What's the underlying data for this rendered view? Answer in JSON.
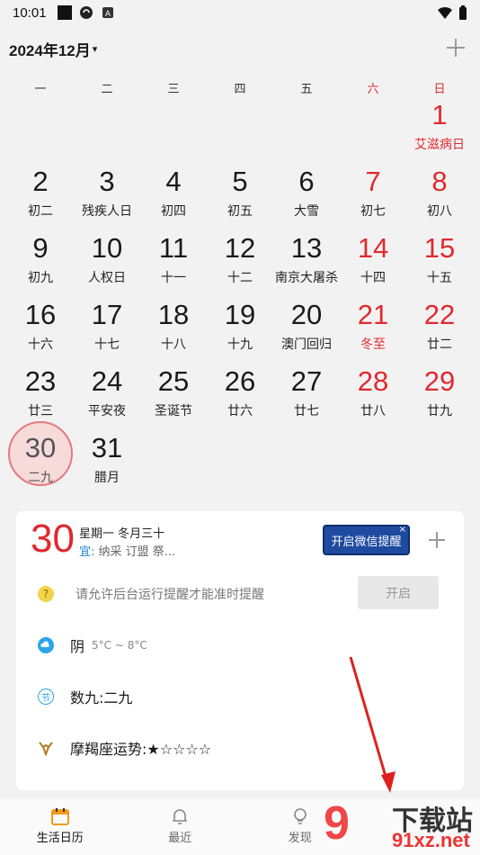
{
  "status_bar": {
    "time": "10:01"
  },
  "header": {
    "month_title": "2024年12月",
    "dropdown_glyph": "▾"
  },
  "weekdays": [
    "一",
    "二",
    "三",
    "四",
    "五",
    "六",
    "日"
  ],
  "calendar": {
    "rows": [
      [
        null,
        null,
        null,
        null,
        null,
        null,
        {
          "day": "1",
          "lunar": "艾滋病日",
          "red": true,
          "lunar_red": true
        }
      ],
      [
        {
          "day": "2",
          "lunar": "初二"
        },
        {
          "day": "3",
          "lunar": "残疾人日"
        },
        {
          "day": "4",
          "lunar": "初四"
        },
        {
          "day": "5",
          "lunar": "初五"
        },
        {
          "day": "6",
          "lunar": "大雪"
        },
        {
          "day": "7",
          "lunar": "初七",
          "red": true
        },
        {
          "day": "8",
          "lunar": "初八",
          "red": true
        }
      ],
      [
        {
          "day": "9",
          "lunar": "初九"
        },
        {
          "day": "10",
          "lunar": "人权日"
        },
        {
          "day": "11",
          "lunar": "十一"
        },
        {
          "day": "12",
          "lunar": "十二"
        },
        {
          "day": "13",
          "lunar": "南京大屠杀"
        },
        {
          "day": "14",
          "lunar": "十四",
          "red": true
        },
        {
          "day": "15",
          "lunar": "十五",
          "red": true
        }
      ],
      [
        {
          "day": "16",
          "lunar": "十六"
        },
        {
          "day": "17",
          "lunar": "十七"
        },
        {
          "day": "18",
          "lunar": "十八"
        },
        {
          "day": "19",
          "lunar": "十九"
        },
        {
          "day": "20",
          "lunar": "澳门回归"
        },
        {
          "day": "21",
          "lunar": "冬至",
          "red": true,
          "lunar_red": true
        },
        {
          "day": "22",
          "lunar": "廿二",
          "red": true
        }
      ],
      [
        {
          "day": "23",
          "lunar": "廿三"
        },
        {
          "day": "24",
          "lunar": "平安夜"
        },
        {
          "day": "25",
          "lunar": "圣诞节"
        },
        {
          "day": "26",
          "lunar": "廿六"
        },
        {
          "day": "27",
          "lunar": "廿七"
        },
        {
          "day": "28",
          "lunar": "廿八",
          "red": true
        },
        {
          "day": "29",
          "lunar": "廿九",
          "red": true
        }
      ],
      [
        {
          "day": "30",
          "lunar": "二九",
          "today": true
        },
        {
          "day": "31",
          "lunar": "腊月"
        },
        null,
        null,
        null,
        null,
        null
      ]
    ]
  },
  "card": {
    "day": "30",
    "weekday_lunar": "星期一 冬月三十",
    "yi_label": "宜:",
    "yi_items": "纳采 订盟 祭...",
    "wechat_button": "开启微信提醒",
    "wechat_close": "×",
    "reminder_text": "请允许后台运行提醒才能准时提醒",
    "open_button": "开启",
    "weather": "阴",
    "weather_range": "5°C ~ 8°C",
    "jieqi_icon_char": "节",
    "shujiu": "数九:二九",
    "horoscope": "摩羯座运势:★☆☆☆☆"
  },
  "tabs": [
    {
      "label": "生活日历",
      "icon": "calendar-icon",
      "active": true
    },
    {
      "label": "最近",
      "icon": "bell-icon"
    },
    {
      "label": "发现",
      "icon": "lightbulb-icon"
    }
  ],
  "watermark": {
    "logo": "9",
    "site": "下载站",
    "url": "91xz.net"
  },
  "colors": {
    "accent_red": "#e0292f",
    "button_blue": "#1e4aa0",
    "yi_blue": "#1e88d0"
  }
}
